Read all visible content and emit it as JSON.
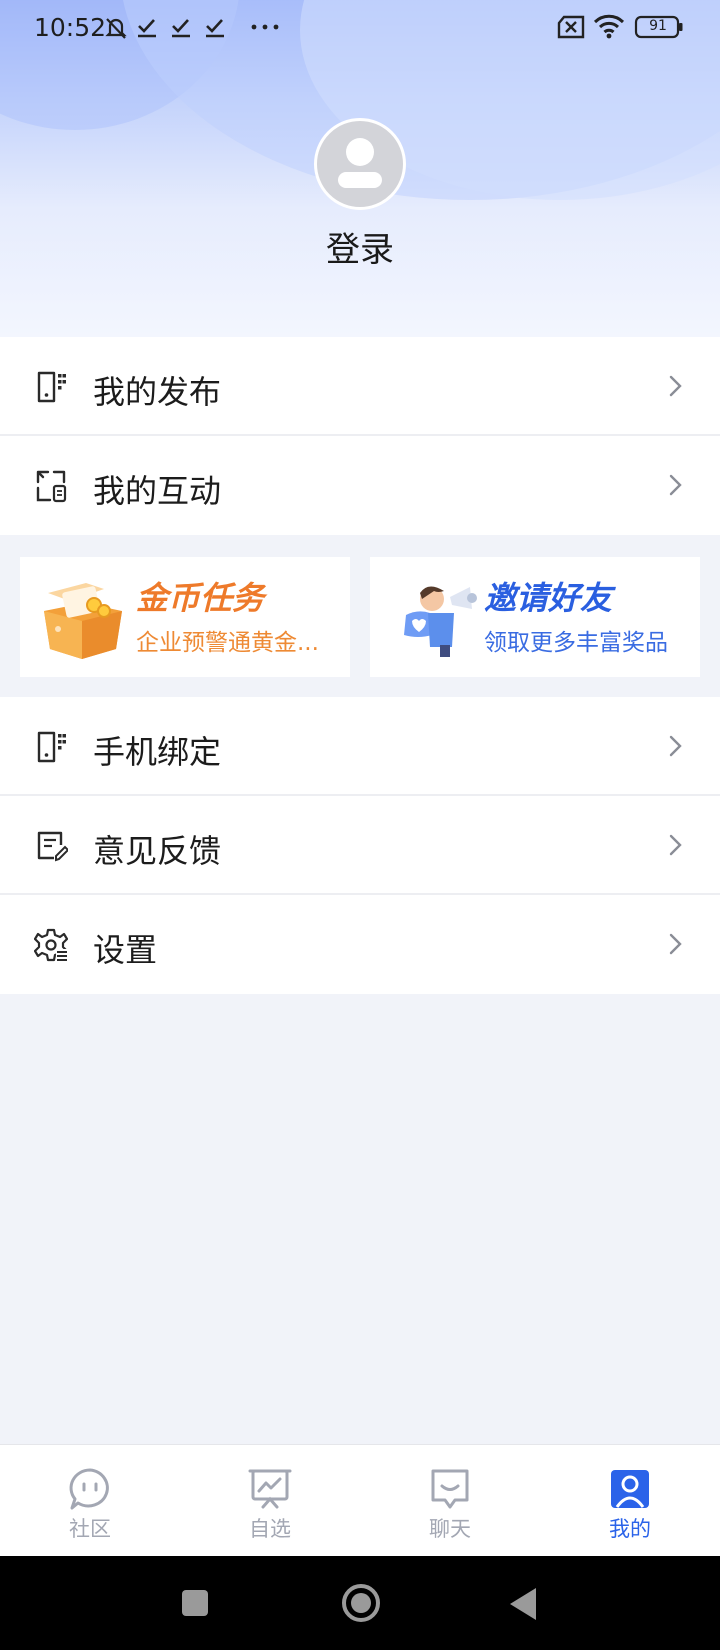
{
  "status_bar": {
    "time": "10:52",
    "battery": "91",
    "icons": [
      "mute-icon",
      "check-icon",
      "check-icon",
      "check-icon",
      "more-dots-icon",
      "sim-off-icon",
      "wifi-icon",
      "battery-icon"
    ]
  },
  "profile": {
    "avatar_icon": "default-avatar-icon",
    "login_label": "登录"
  },
  "menu_top": [
    {
      "label": "我的发布",
      "icon": "document-icon"
    },
    {
      "label": "我的互动",
      "icon": "interaction-icon"
    }
  ],
  "promos": [
    {
      "title": "金币任务",
      "subtitle": "企业预警通黄金...",
      "title_color": "#ee7a2a",
      "subtitle_color": "#ee8a34"
    },
    {
      "title": "邀请好友",
      "subtitle": "领取更多丰富奖品",
      "title_color": "#2a5fe0",
      "subtitle_color": "#3a6ce2"
    }
  ],
  "menu_bottom": [
    {
      "label": "手机绑定",
      "icon": "phone-icon"
    },
    {
      "label": "意见反馈",
      "icon": "feedback-icon"
    },
    {
      "label": "设置",
      "icon": "gear-icon"
    }
  ],
  "tabs": [
    {
      "label": "社区",
      "icon": "chat-bubble-icon",
      "active": false
    },
    {
      "label": "自选",
      "icon": "chart-board-icon",
      "active": false
    },
    {
      "label": "聊天",
      "icon": "message-icon",
      "active": false
    },
    {
      "label": "我的",
      "icon": "profile-icon",
      "active": true
    }
  ],
  "colors": {
    "accent": "#2b63e9",
    "inactive_tab": "#a3a7b3",
    "background": "#f1f3f9"
  }
}
